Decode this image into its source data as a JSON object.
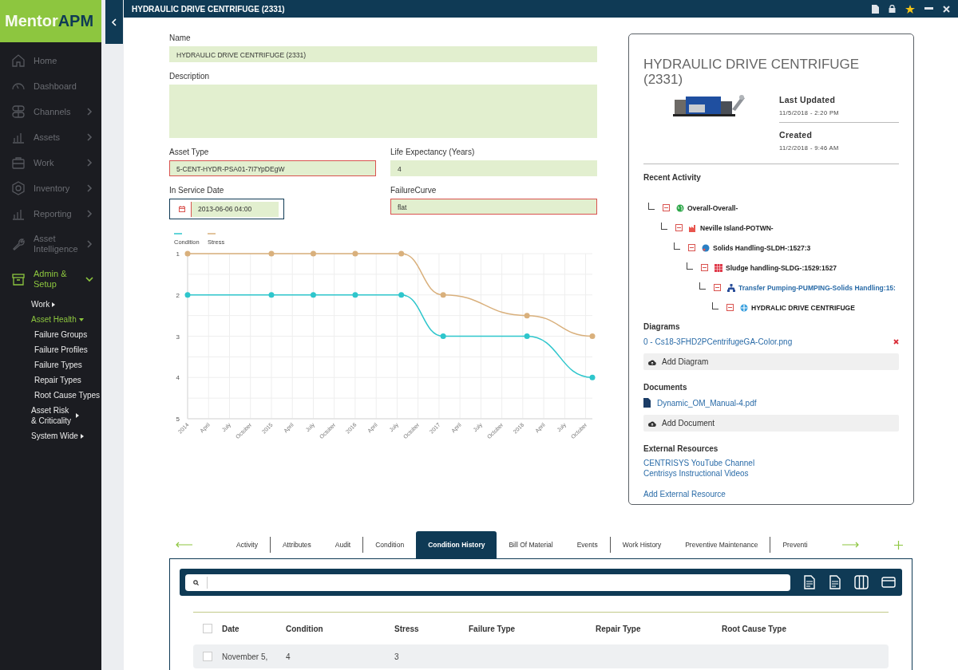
{
  "window": {
    "title": "HYDRAULIC DRIVE CENTRIFUGE (2331)"
  },
  "sidebar": {
    "logo": {
      "name": "Mentor",
      "suffix": "APM"
    },
    "items": [
      {
        "label": "Home",
        "has_submenu": false,
        "selected": false
      },
      {
        "label": "Dashboard",
        "has_submenu": false,
        "selected": false
      },
      {
        "label": "Channels",
        "has_submenu": true,
        "selected": false,
        "expanded": false
      },
      {
        "label": "Assets",
        "has_submenu": true,
        "selected": false,
        "expanded": false
      },
      {
        "label": "Work",
        "has_submenu": true,
        "selected": false,
        "expanded": false
      },
      {
        "label": "Inventory",
        "has_submenu": true,
        "selected": false,
        "expanded": false
      },
      {
        "label": "Reporting",
        "has_submenu": true,
        "selected": false,
        "expanded": false
      },
      {
        "label": "Asset Intelligence",
        "has_submenu": true,
        "selected": false,
        "expanded": false
      },
      {
        "label": "Admin & Setup",
        "has_submenu": true,
        "selected": true,
        "expanded": true,
        "children": [
          {
            "label": "Work",
            "has_submenu": true,
            "selected": false,
            "expanded": false
          },
          {
            "label": "Asset Health",
            "has_submenu": true,
            "selected": true,
            "expanded": true,
            "children": [
              {
                "label": "Failure Groups",
                "selected": false
              },
              {
                "label": "Failure Profiles",
                "selected": false
              },
              {
                "label": "Failure Types",
                "selected": false
              },
              {
                "label": "Repair Types",
                "selected": false
              },
              {
                "label": "Root Cause Types",
                "selected": false
              }
            ]
          },
          {
            "label": "Asset Risk & Criticality",
            "has_submenu": true,
            "selected": false,
            "expanded": false
          },
          {
            "label": "System Wide",
            "has_submenu": true,
            "selected": false,
            "expanded": false
          }
        ]
      }
    ]
  },
  "form": {
    "fields": [
      {
        "label": "Name",
        "kind": "text",
        "value": "HYDRAULIC DRIVE CENTRIFUGE (2331)",
        "invalid": false
      },
      {
        "label": "Description",
        "kind": "textarea",
        "invalid": false
      },
      {
        "label": "Asset Type",
        "kind": "text",
        "value": "5-CENT-HYDR-PSA01-7I7YpDEgW",
        "invalid": true
      },
      {
        "label": "Life Expectancy (Years)",
        "kind": "text",
        "value": "4",
        "invalid": false
      },
      {
        "label": "In Service Date",
        "kind": "date",
        "value": "2013-06-06 04:00",
        "focused": true
      },
      {
        "label": "FailureCurve",
        "kind": "text",
        "value": "flat",
        "invalid": true
      }
    ]
  },
  "chart": {
    "chart_data": {
      "type": "line",
      "grid": true,
      "legend": "top-left",
      "ylim": [
        5,
        1
      ],
      "xlim": [
        2014,
        2018.83
      ],
      "yticks": [
        1,
        2,
        3,
        4,
        5
      ],
      "xticks": [
        {
          "value": 2014,
          "label": "2014"
        },
        {
          "value": 2014.25,
          "label": "April"
        },
        {
          "value": 2014.5,
          "label": "July"
        },
        {
          "value": 2014.75,
          "label": "October"
        },
        {
          "value": 2015,
          "label": "2015"
        },
        {
          "value": 2015.25,
          "label": "April"
        },
        {
          "value": 2015.5,
          "label": "July"
        },
        {
          "value": 2015.75,
          "label": "October"
        },
        {
          "value": 2016,
          "label": "2016"
        },
        {
          "value": 2016.25,
          "label": "April"
        },
        {
          "value": 2016.5,
          "label": "July"
        },
        {
          "value": 2016.75,
          "label": "October"
        },
        {
          "value": 2017,
          "label": "2017"
        },
        {
          "value": 2017.25,
          "label": "April"
        },
        {
          "value": 2017.5,
          "label": "July"
        },
        {
          "value": 2017.75,
          "label": "October"
        },
        {
          "value": 2018,
          "label": "2018"
        },
        {
          "value": 2018.25,
          "label": "April"
        },
        {
          "value": 2018.5,
          "label": "July"
        },
        {
          "value": 2018.75,
          "label": "October"
        }
      ],
      "x": [
        2014,
        2015,
        2015.5,
        2016,
        2016.55,
        2017.05,
        2018.05,
        2018.83
      ],
      "series": [
        {
          "name": "Condition",
          "color": "#2ec6cc",
          "marker": "circle",
          "values": [
            2,
            2,
            2,
            2,
            2,
            3,
            3,
            4
          ]
        },
        {
          "name": "Stress",
          "color": "#d9b07c",
          "marker": "circle",
          "values": [
            1,
            1,
            1,
            1,
            1,
            2,
            2.5,
            3
          ]
        }
      ]
    }
  },
  "panel": {
    "title": "HYDRAULIC DRIVE CENTRIFUGE (2331)",
    "last_updated": {
      "label": "Last Updated",
      "value": "11/5/2018 - 2:20 PM"
    },
    "created": {
      "label": "Created",
      "value": "11/2/2018 - 9:46 AM"
    },
    "recent_activity": {
      "title": "Recent Activity",
      "tree": [
        {
          "label": "Overall-Overall-",
          "expanded": true,
          "selected": false,
          "children": [
            {
              "label": "Neville Island-POTWN-",
              "expanded": true,
              "selected": false,
              "children": [
                {
                  "label": "Solids Handling-SLDH-:1527:3",
                  "expanded": true,
                  "selected": false,
                  "children": [
                    {
                      "label": "Sludge handling-SLDG-:1529:1527",
                      "expanded": true,
                      "selected": false,
                      "children": [
                        {
                          "label": "Transfer Pumping-PUMPING-Solids Handling:15:",
                          "expanded": true,
                          "selected": true,
                          "children": [
                            {
                              "label": "HYDRALIC DRIVE CENTRIFUGE",
                              "expanded": true,
                              "selected": false
                            }
                          ]
                        }
                      ]
                    }
                  ]
                }
              ]
            }
          ]
        }
      ]
    },
    "diagrams": {
      "title": "Diagrams",
      "items": [
        "0 - Cs18-3FHD2PCentrifugeGA-Color.png"
      ],
      "add_label": "Add Diagram"
    },
    "documents": {
      "title": "Documents",
      "items": [
        "Dynamic_OM_Manual-4.pdf"
      ],
      "add_label": "Add Document"
    },
    "external_resources": {
      "title": "External Resources",
      "links": [
        "CENTRISYS YouTube Channel",
        "Centrisys Instructional Videos"
      ],
      "add_label": "Add External Resource"
    }
  },
  "tabs": [
    {
      "label": "Activity",
      "selected": false
    },
    {
      "label": "Attributes",
      "selected": false
    },
    {
      "label": "Audit",
      "selected": false
    },
    {
      "label": "Condition",
      "selected": false
    },
    {
      "label": "Condition History",
      "selected": true
    },
    {
      "label": "Bill Of Material",
      "selected": false
    },
    {
      "label": "Events",
      "selected": false
    },
    {
      "label": "Work History",
      "selected": false
    },
    {
      "label": "Preventive Maintenance",
      "selected": false
    },
    {
      "label": "Preventi",
      "selected": false
    }
  ],
  "history": {
    "all_checked": false,
    "columns": [
      "Date",
      "Condition",
      "Stress",
      "Failure Type",
      "Repair Type",
      "Root Cause Type"
    ],
    "rows": [
      {
        "checked": false,
        "cells": [
          "November 5,",
          "4",
          "3"
        ]
      }
    ]
  }
}
